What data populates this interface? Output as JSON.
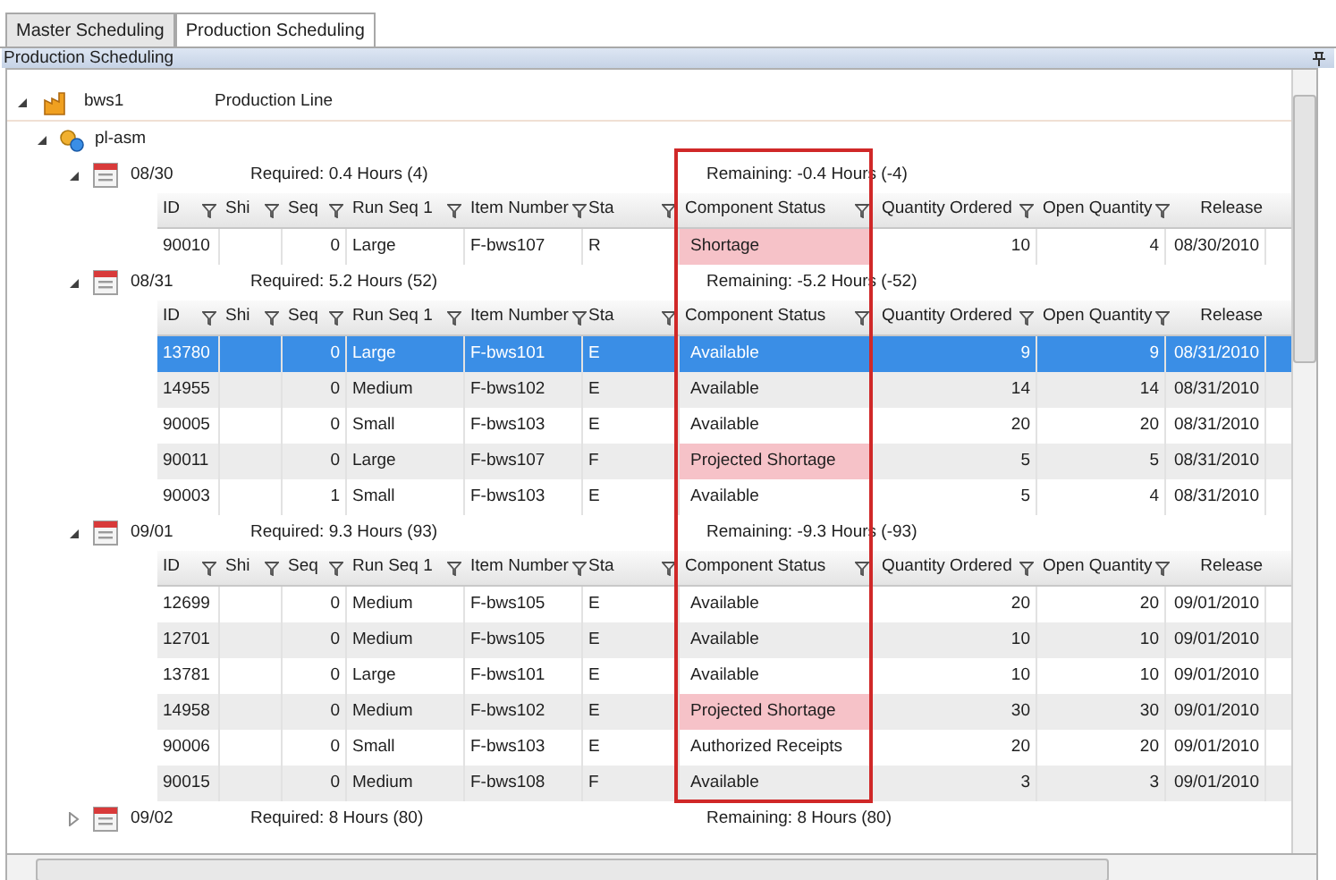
{
  "tabs": [
    {
      "label": "Master Scheduling",
      "selected": false
    },
    {
      "label": "Production Scheduling",
      "selected": true
    }
  ],
  "panel": {
    "title": "Production Scheduling"
  },
  "tree": {
    "label": "bws1",
    "description": "Production Line",
    "expanded": true,
    "children": [
      {
        "label": "pl-asm",
        "expanded": true,
        "groups": [
          {
            "date": "08/30",
            "required": "Required: 0.4 Hours (4)",
            "remaining": "Remaining: -0.4 Hours (-4)",
            "expanded": true,
            "columns": [
              {
                "label": "ID",
                "filter": true
              },
              {
                "label": "Shi",
                "filter": true
              },
              {
                "label": "Seq",
                "filter": true
              },
              {
                "label": "Run Seq 1",
                "filter": true
              },
              {
                "label": "Item Number",
                "filter": true
              },
              {
                "label": "Sta",
                "filter": true
              },
              {
                "label": "Component Status",
                "filter": true
              },
              {
                "label": "Quantity Ordered",
                "filter": true
              },
              {
                "label": "Open Quantity",
                "filter": true
              },
              {
                "label": "Release",
                "filter": false
              }
            ],
            "rows": [
              {
                "cells": [
                  "90010",
                  "",
                  "0",
                  "Large",
                  "F-bws107",
                  "R",
                  "Shortage",
                  "10",
                  "4",
                  "08/30/2010"
                ],
                "alert": true,
                "selected": false
              }
            ]
          },
          {
            "date": "08/31",
            "required": "Required: 5.2 Hours (52)",
            "remaining": "Remaining: -5.2 Hours (-52)",
            "expanded": true,
            "columns": [
              {
                "label": "ID",
                "filter": true
              },
              {
                "label": "Shi",
                "filter": true
              },
              {
                "label": "Seq",
                "filter": true
              },
              {
                "label": "Run Seq 1",
                "filter": true
              },
              {
                "label": "Item Number",
                "filter": true
              },
              {
                "label": "Sta",
                "filter": true
              },
              {
                "label": "Component Status",
                "filter": true
              },
              {
                "label": "Quantity Ordered",
                "filter": true
              },
              {
                "label": "Open Quantity",
                "filter": true
              },
              {
                "label": "Release",
                "filter": false
              }
            ],
            "rows": [
              {
                "cells": [
                  "13780",
                  "",
                  "0",
                  "Large",
                  "F-bws101",
                  "E",
                  "Available",
                  "9",
                  "9",
                  "08/31/2010"
                ],
                "alert": false,
                "selected": true
              },
              {
                "cells": [
                  "14955",
                  "",
                  "0",
                  "Medium",
                  "F-bws102",
                  "E",
                  "Available",
                  "14",
                  "14",
                  "08/31/2010"
                ],
                "alert": false,
                "selected": false
              },
              {
                "cells": [
                  "90005",
                  "",
                  "0",
                  "Small",
                  "F-bws103",
                  "E",
                  "Available",
                  "20",
                  "20",
                  "08/31/2010"
                ],
                "alert": false,
                "selected": false
              },
              {
                "cells": [
                  "90011",
                  "",
                  "0",
                  "Large",
                  "F-bws107",
                  "F",
                  "Projected Shortage",
                  "5",
                  "5",
                  "08/31/2010"
                ],
                "alert": true,
                "selected": false
              },
              {
                "cells": [
                  "90003",
                  "",
                  "1",
                  "Small",
                  "F-bws103",
                  "E",
                  "Available",
                  "5",
                  "4",
                  "08/31/2010"
                ],
                "alert": false,
                "selected": false
              }
            ]
          },
          {
            "date": "09/01",
            "required": "Required: 9.3 Hours (93)",
            "remaining": "Remaining: -9.3 Hours (-93)",
            "expanded": true,
            "columns": [
              {
                "label": "ID",
                "filter": true
              },
              {
                "label": "Shi",
                "filter": true
              },
              {
                "label": "Seq",
                "filter": true
              },
              {
                "label": "Run Seq 1",
                "filter": true
              },
              {
                "label": "Item Number",
                "filter": true
              },
              {
                "label": "Sta",
                "filter": true
              },
              {
                "label": "Component Status",
                "filter": true
              },
              {
                "label": "Quantity Ordered",
                "filter": true
              },
              {
                "label": "Open Quantity",
                "filter": true
              },
              {
                "label": "Release",
                "filter": false
              }
            ],
            "rows": [
              {
                "cells": [
                  "12699",
                  "",
                  "0",
                  "Medium",
                  "F-bws105",
                  "E",
                  "Available",
                  "20",
                  "20",
                  "09/01/2010"
                ],
                "alert": false,
                "selected": false
              },
              {
                "cells": [
                  "12701",
                  "",
                  "0",
                  "Medium",
                  "F-bws105",
                  "E",
                  "Available",
                  "10",
                  "10",
                  "09/01/2010"
                ],
                "alert": false,
                "selected": false
              },
              {
                "cells": [
                  "13781",
                  "",
                  "0",
                  "Large",
                  "F-bws101",
                  "E",
                  "Available",
                  "10",
                  "10",
                  "09/01/2010"
                ],
                "alert": false,
                "selected": false
              },
              {
                "cells": [
                  "14958",
                  "",
                  "0",
                  "Medium",
                  "F-bws102",
                  "E",
                  "Projected Shortage",
                  "30",
                  "30",
                  "09/01/2010"
                ],
                "alert": true,
                "selected": false
              },
              {
                "cells": [
                  "90006",
                  "",
                  "0",
                  "Small",
                  "F-bws103",
                  "E",
                  "Authorized Receipts",
                  "20",
                  "20",
                  "09/01/2010"
                ],
                "alert": false,
                "selected": false
              },
              {
                "cells": [
                  "90015",
                  "",
                  "0",
                  "Medium",
                  "F-bws108",
                  "F",
                  "Available",
                  "3",
                  "3",
                  "09/01/2010"
                ],
                "alert": false,
                "selected": false
              }
            ]
          },
          {
            "date": "09/02",
            "required": "Required: 8 Hours (80)",
            "remaining": "Remaining: 8 Hours (80)",
            "expanded": false
          }
        ]
      }
    ]
  }
}
